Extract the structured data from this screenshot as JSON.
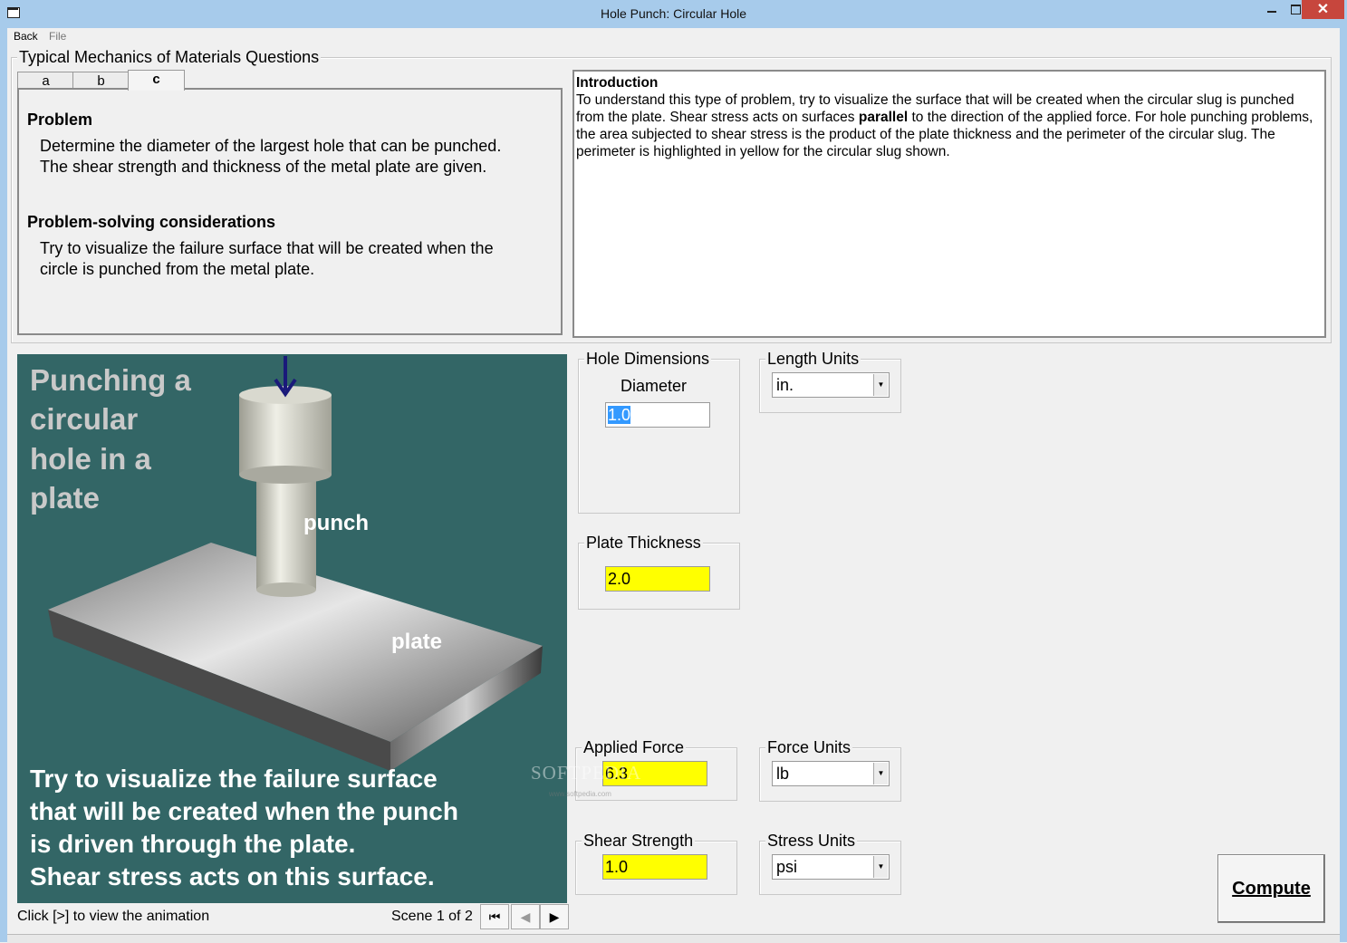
{
  "window": {
    "title": "Hole Punch:  Circular Hole",
    "close_glyph": "✕"
  },
  "menu": {
    "back": "Back",
    "file": "File"
  },
  "questions": {
    "legend": "Typical Mechanics of Materials Questions",
    "tabs": [
      {
        "label": "a"
      },
      {
        "label": "b"
      },
      {
        "label": "c",
        "selected": true
      }
    ],
    "problem_heading": "Problem",
    "problem_line1": "Determine the diameter of the largest hole that can be punched.",
    "problem_line2": "The shear strength and thickness of the metal plate are given.",
    "considerations_heading": "Problem-solving considerations",
    "considerations_line1": "Try to visualize the failure surface that will be created when the",
    "considerations_line2": "circle is punched from the metal plate."
  },
  "intro": {
    "heading": "Introduction",
    "text_a": "To understand this type of problem, try to visualize the surface that will be created when the circular slug is punched from the plate.  Shear stress acts on surfaces ",
    "text_bold": "parallel",
    "text_b": " to the direction of the applied force.  For hole punching problems, the area subjected to shear stress is the product of the plate thickness and the perimeter of the circular slug.  The perimeter is highlighted in yellow for the circular slug shown."
  },
  "animation": {
    "title_line1": "Punching a",
    "title_line2": "circular",
    "title_line3": "hole in a",
    "title_line4": "plate",
    "punch_label": "punch",
    "plate_label": "plate",
    "caption_line1": "Try to visualize the failure surface",
    "caption_line2": "that will be created when the punch",
    "caption_line3": "is driven through the plate.",
    "caption_line4": "Shear stress acts on this surface.",
    "instruction": "Click [>] to view the animation",
    "scene_text": "Scene 1 of 2",
    "nav_first": "⏮",
    "nav_prev": "◀",
    "nav_next": "▶",
    "watermark": "SOFTPEDIA",
    "watermark_url": "www.softpedia.com"
  },
  "hole_dimensions": {
    "legend": "Hole Dimensions",
    "diameter_label": "Diameter",
    "diameter_value": "1.0"
  },
  "length_units": {
    "legend": "Length Units",
    "selected": "in."
  },
  "plate_thickness": {
    "legend": "Plate Thickness",
    "value": "2.0"
  },
  "applied_force": {
    "legend": "Applied Force",
    "value": "6.3"
  },
  "force_units": {
    "legend": "Force Units",
    "selected": "lb"
  },
  "shear_strength": {
    "legend": "Shear Strength",
    "value": "1.0"
  },
  "stress_units": {
    "legend": "Stress Units",
    "selected": "psi"
  },
  "compute_label": "Compute",
  "colors": {
    "titlebar": "#a7cbeb",
    "animation_bg": "#336666",
    "input_highlight": "#ffff00",
    "selection": "#3399ff",
    "close_button": "#c7463d"
  }
}
